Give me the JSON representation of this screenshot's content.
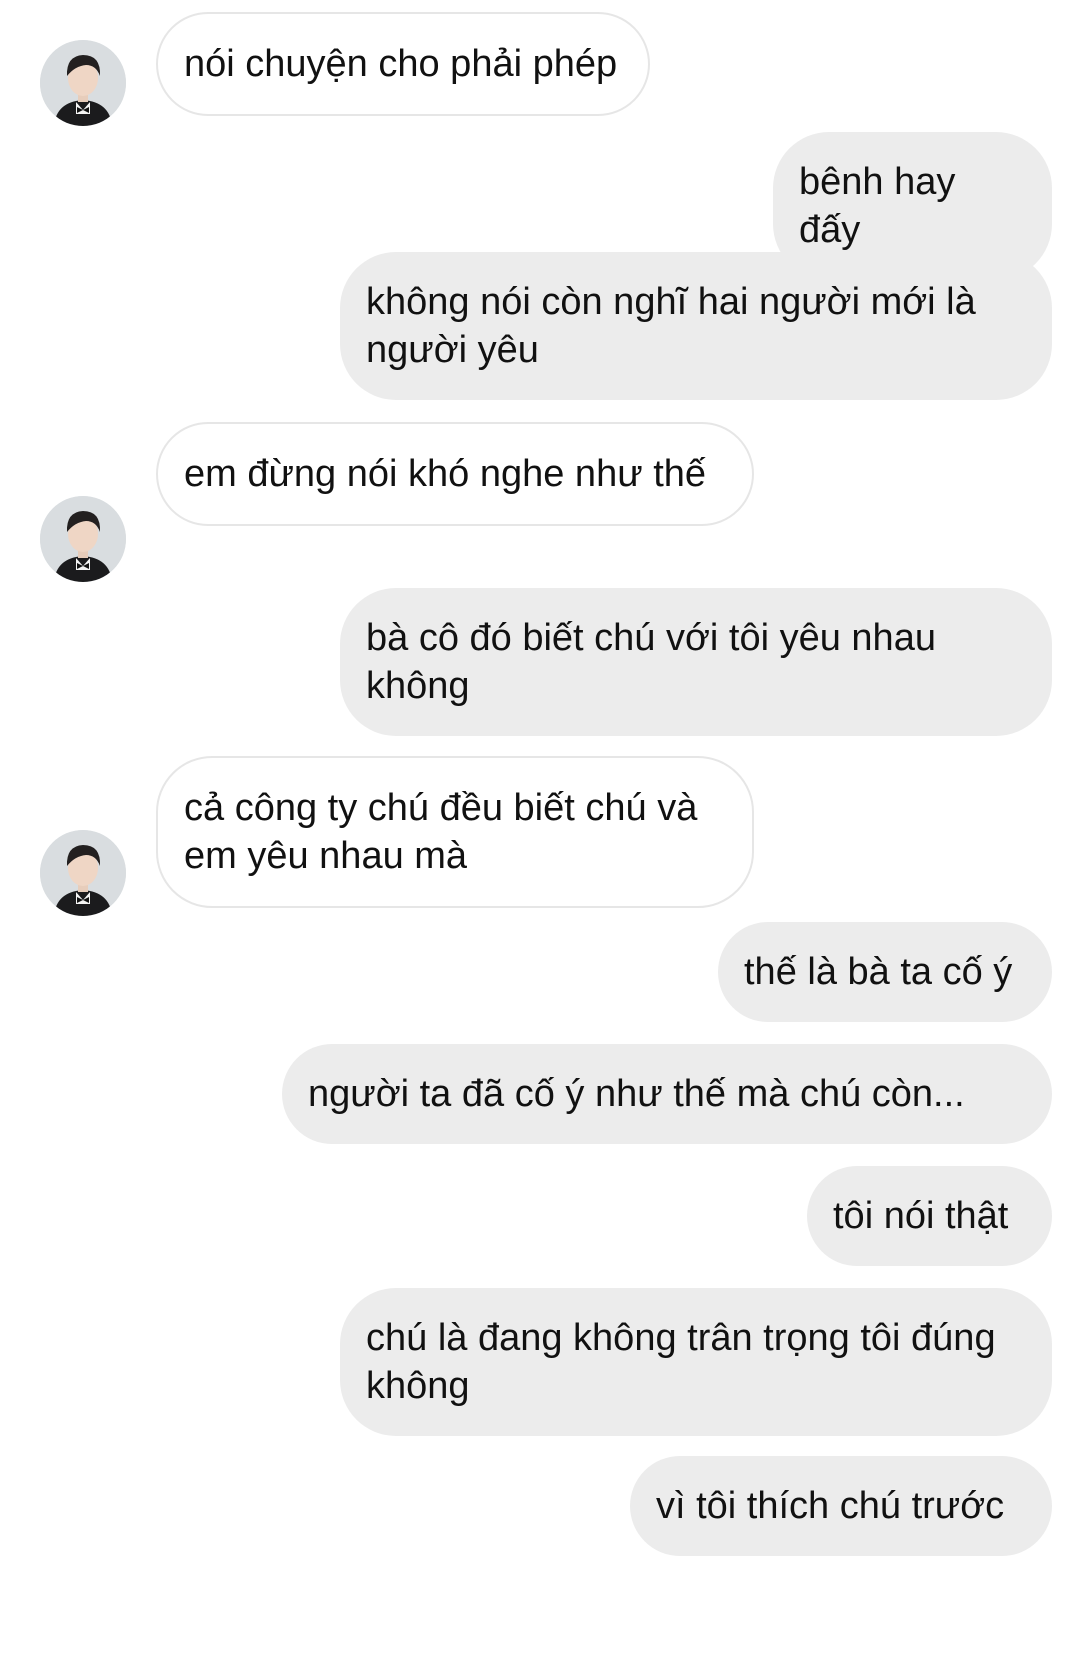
{
  "conversation": {
    "messages": [
      {
        "sender": "other",
        "text": "nói chuyện cho phải phép"
      },
      {
        "sender": "me",
        "text": "bênh hay đấy"
      },
      {
        "sender": "me",
        "text": "không nói còn nghĩ hai người mới là người yêu"
      },
      {
        "sender": "other",
        "text": "em đừng nói khó nghe như thế"
      },
      {
        "sender": "me",
        "text": "bà cô đó biết chú với tôi yêu nhau không"
      },
      {
        "sender": "other",
        "text": "cả công ty chú đều biết chú và em yêu nhau mà"
      },
      {
        "sender": "me",
        "text": "thế là bà ta cố ý"
      },
      {
        "sender": "me",
        "text": "người ta đã cố ý như thế mà chú còn..."
      },
      {
        "sender": "me",
        "text": "tôi nói thật"
      },
      {
        "sender": "me",
        "text": "chú là đang không trân trọng tôi đúng không"
      },
      {
        "sender": "me",
        "text": "vì tôi thích chú trước"
      }
    ]
  },
  "colors": {
    "outgoing_bubble": "#ececec",
    "incoming_bubble": "#ffffff",
    "incoming_border": "#e6e6e6",
    "text": "#111111"
  },
  "icons": {
    "avatar": "avatar-icon"
  }
}
